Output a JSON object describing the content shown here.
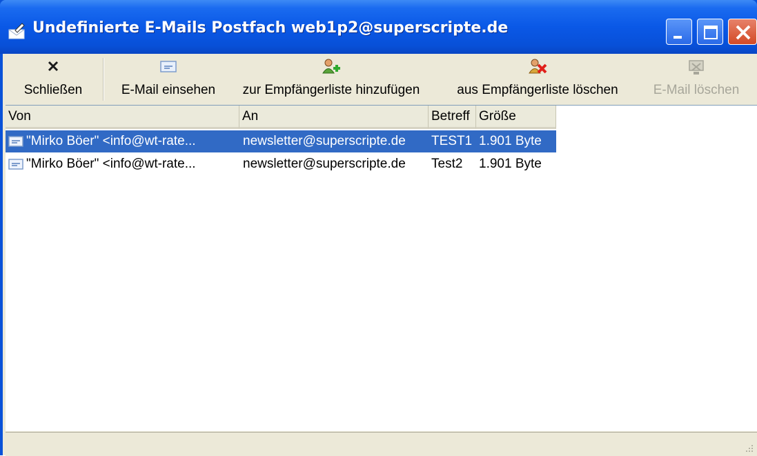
{
  "window": {
    "title": "Undefinierte E-Mails Postfach web1p2@superscripte.de",
    "icons": {
      "app": "envelope-pen-icon",
      "minimize": "minimize-icon",
      "maximize": "maximize-icon",
      "close": "close-icon"
    }
  },
  "toolbar": {
    "close_label": "Schließen",
    "view_label": "E-Mail einsehen",
    "add_label": "zur Empfängerliste hinzufügen",
    "remove_label": "aus Empfängerliste löschen",
    "delete_label": "E-Mail löschen"
  },
  "list": {
    "columns": [
      "Von",
      "An",
      "Betreff",
      "Größe"
    ],
    "rows": [
      {
        "from": "\"Mirko Böer\" <info@wt-rate...",
        "to": "newsletter@superscripte.de",
        "subject": "TEST1",
        "size": "1.901 Byte",
        "selected": true
      },
      {
        "from": "\"Mirko Böer\" <info@wt-rate...",
        "to": "newsletter@superscripte.de",
        "subject": "Test2",
        "size": "1.901 Byte",
        "selected": false
      }
    ]
  },
  "colors": {
    "titlebar": "#0a58e6",
    "selection": "#316ac5",
    "face": "#ece9d8"
  }
}
